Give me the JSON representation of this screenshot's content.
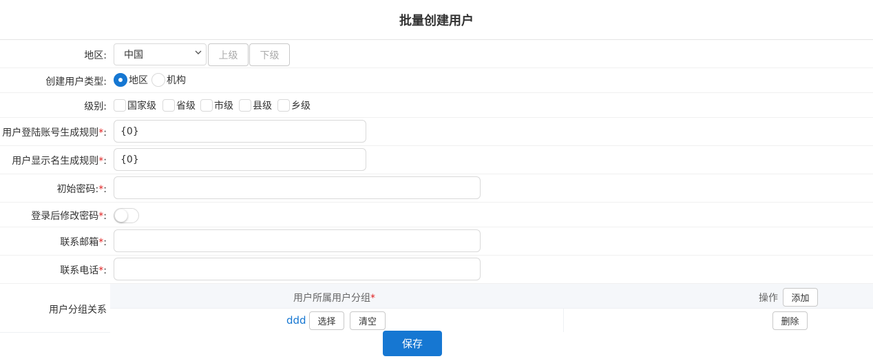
{
  "page": {
    "title": "批量创建用户"
  },
  "region": {
    "label": "地区:",
    "select_value": "中国",
    "up_label": "上级",
    "down_label": "下级"
  },
  "user_type": {
    "label": "创建用户类型:",
    "options": [
      {
        "label": "地区",
        "selected": true
      },
      {
        "label": "机构",
        "selected": false
      }
    ]
  },
  "level": {
    "label": "级别:",
    "options": [
      {
        "label": "国家级",
        "checked": false
      },
      {
        "label": "省级",
        "checked": false
      },
      {
        "label": "市级",
        "checked": false
      },
      {
        "label": "县级",
        "checked": false
      },
      {
        "label": "乡级",
        "checked": false
      }
    ]
  },
  "login_rule": {
    "label": "用户登陆账号生成规则",
    "required_mark": "*",
    "colon": ":",
    "value": "{0}"
  },
  "display_rule": {
    "label": "用户显示名生成规则",
    "required_mark": "*",
    "colon": ":",
    "value": "{0}"
  },
  "init_password": {
    "label": "初始密码:",
    "required_mark": "*",
    "colon": ":",
    "value": ""
  },
  "change_pwd": {
    "label": "登录后修改密码",
    "required_mark": "*",
    "colon": ":",
    "enabled": false
  },
  "email": {
    "label": "联系邮箱",
    "required_mark": "*",
    "colon": ":",
    "value": ""
  },
  "phone": {
    "label": "联系电话",
    "required_mark": "*",
    "colon": ":",
    "value": ""
  },
  "group": {
    "label": "用户分组关系",
    "col_group": "用户所属用户分组",
    "col_group_required": "*",
    "col_action": "操作",
    "add_label": "添加",
    "rows": [
      {
        "group": "ddd",
        "select_label": "选择",
        "clear_label": "清空",
        "delete_label": "删除"
      }
    ]
  },
  "save_label": "保存",
  "colors": {
    "primary": "#1677d2",
    "required": "#e02020",
    "link": "#1677d2"
  }
}
